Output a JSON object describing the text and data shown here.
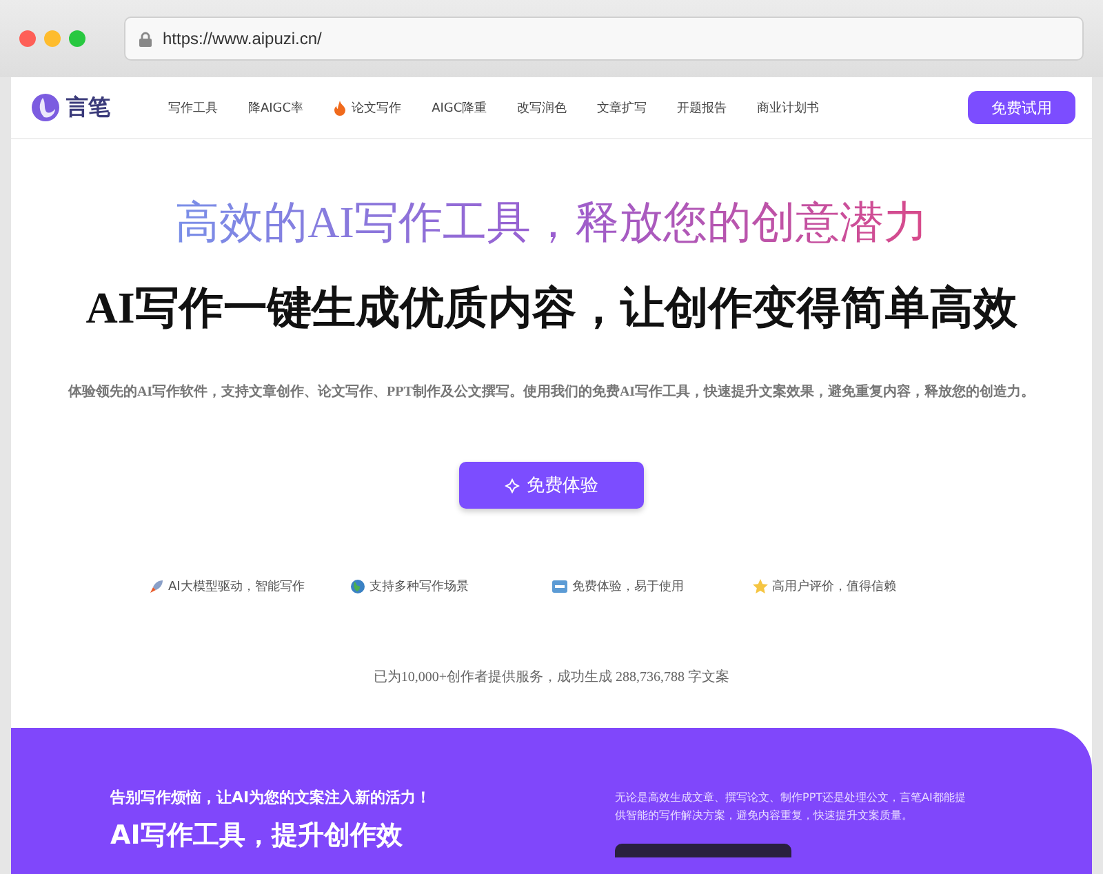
{
  "browser": {
    "url": "https://www.aipuzi.cn/"
  },
  "nav": {
    "brand": "言笔",
    "items": [
      {
        "label": "写作工具",
        "kind": "plain"
      },
      {
        "label": "降AIGC率",
        "kind": "plain"
      },
      {
        "label": "论文写作",
        "kind": "hot"
      },
      {
        "label": "AIGC降重",
        "kind": "plain"
      },
      {
        "label": "改写润色",
        "kind": "plain"
      },
      {
        "label": "文章扩写",
        "kind": "plain"
      },
      {
        "label": "开题报告",
        "kind": "plain"
      },
      {
        "label": "商业计划书",
        "kind": "plain"
      }
    ],
    "cta": "免费试用"
  },
  "hero": {
    "title": "高效的AI写作工具，释放您的创意潜力",
    "subtitle": "AI写作一键生成优质内容，让创作变得简单高效",
    "description": "体验领先的AI写作软件，支持文章创作、论文写作、PPT制作及公文撰写。使用我们的免费AI写作工具，快速提升文案效果，避免重复内容，释放您的创造力。",
    "button": "免费体验",
    "features": [
      {
        "kind": "rocket",
        "label": "AI大模型驱动，智能写作"
      },
      {
        "kind": "globe",
        "label": "支持多种写作场景"
      },
      {
        "kind": "free",
        "label": "免费体验，易于使用"
      },
      {
        "kind": "star",
        "label": "高用户评价，值得信赖"
      }
    ],
    "stats": "已为10,000+创作者提供服务，成功生成 288,736,788 字文案"
  },
  "promo": {
    "tagline": "告别写作烦恼，让AI为您的文案注入新的活力！",
    "heading": "AI写作工具，提升创作效",
    "text": "无论是高效生成文章、撰写论文、制作PPT还是处理公文，言笔AI都能提供智能的写作解决方案，避免内容重复，快速提升文案质量。"
  }
}
